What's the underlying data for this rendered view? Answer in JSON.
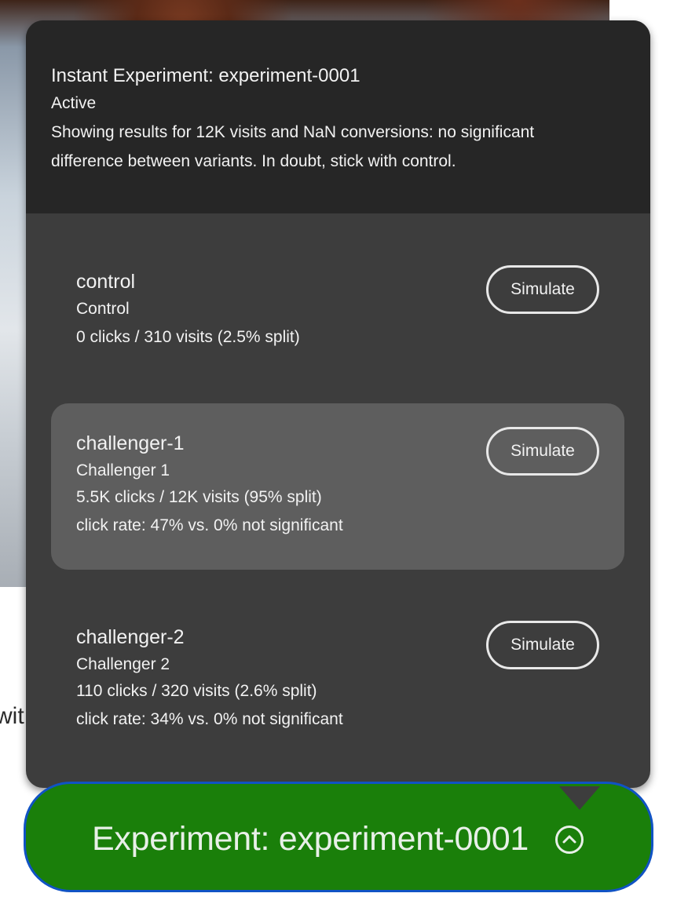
{
  "experiment": {
    "title": "Instant Experiment: experiment-0001",
    "status": "Active",
    "summary": "Showing results for 12K visits and NaN conversions: no significant difference between variants. In doubt, stick with control."
  },
  "variants": [
    {
      "name": "control",
      "label": "Control",
      "stats": "0 clicks / 310 visits (2.5% split)",
      "rate": "",
      "button": "Simulate"
    },
    {
      "name": "challenger-1",
      "label": "Challenger 1",
      "stats": "5.5K clicks / 12K visits (95% split)",
      "rate": "click rate: 47% vs. 0% not significant",
      "button": "Simulate"
    },
    {
      "name": "challenger-2",
      "label": "Challenger 2",
      "stats": "110 clicks / 320 visits (2.6% split)",
      "rate": "click rate: 34% vs. 0% not significant",
      "button": "Simulate"
    }
  ],
  "pill": {
    "label": "Experiment: experiment-0001",
    "icon": "chevron-up-circle-icon"
  },
  "background": {
    "partial_text": "wit"
  },
  "colors": {
    "pill_bg": "#1a7f0a",
    "pill_border": "#1053c4",
    "popover_header": "#262626",
    "popover_body": "#3d3d3d",
    "variant_highlight": "#5e5e5e"
  }
}
